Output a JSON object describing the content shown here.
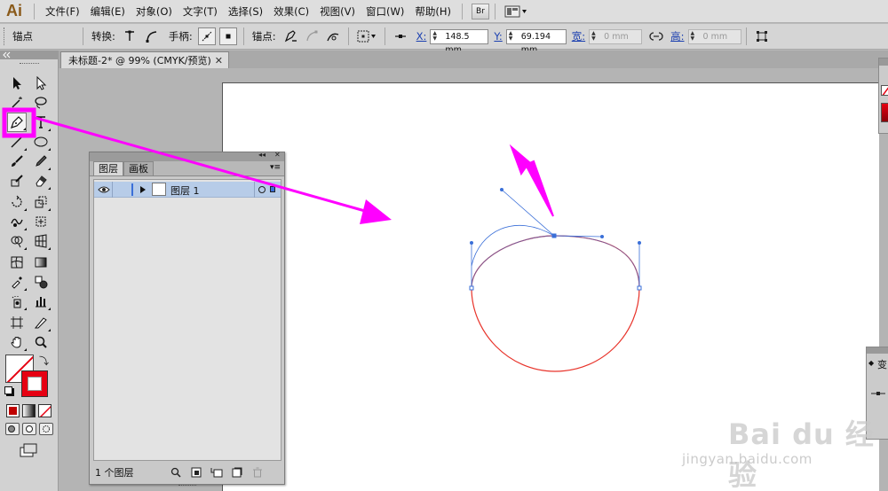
{
  "app": {
    "logo": "Ai"
  },
  "menu": {
    "items": [
      "文件(F)",
      "编辑(E)",
      "对象(O)",
      "文字(T)",
      "选择(S)",
      "效果(C)",
      "视图(V)",
      "窗口(W)",
      "帮助(H)"
    ],
    "bridge_label": "Br"
  },
  "control": {
    "tool_name": "锚点",
    "convert_label": "转换:",
    "handles_label": "手柄:",
    "anchor_label": "锚点:",
    "x_label": "X:",
    "x_value": "148.5 mm",
    "y_label": "Y:",
    "y_value": "69.194 mm",
    "w_label": "宽:",
    "w_value": "0 mm",
    "h_label": "高:",
    "h_value": "0 mm"
  },
  "document": {
    "tab_title": "未标题-2* @ 99% (CMYK/预览)",
    "close_glyph": "✕"
  },
  "layers_panel": {
    "collapse_glyph": "◂◂",
    "close_glyph": "✕",
    "tabs": [
      "图层",
      "画板"
    ],
    "menu_glyph": "▾≡",
    "layer_name": "图层 1",
    "layer_count": "1 个图层"
  },
  "right_panel": {
    "label": "变"
  },
  "watermark": {
    "brand": "Bai du 经验",
    "url": "jingyan.baidu.com"
  },
  "colors": {
    "highlight": "#ff00ff",
    "path_stroke": "#e8332a",
    "handle": "#3a6fd8",
    "layer_selected": "#b7cce8",
    "stroke_swatch": "#e60012"
  }
}
